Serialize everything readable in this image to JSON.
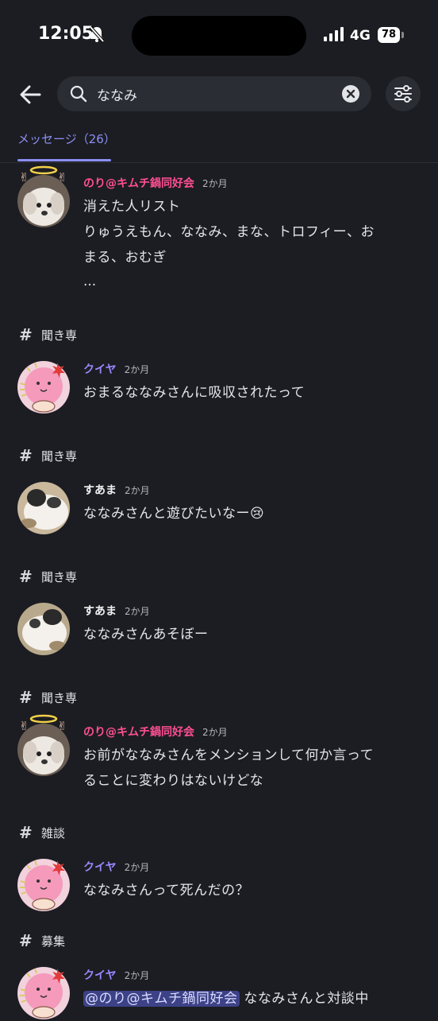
{
  "status": {
    "time": "12:05",
    "network": "4G",
    "battery": "78"
  },
  "search": {
    "query": "ななみ",
    "placeholder": ""
  },
  "tab": {
    "label": "メッセージ（26）"
  },
  "colors": {
    "accent": "#8c8ff5",
    "pink_name": "#ff4f93",
    "purple_name": "#9b86ff",
    "mention_bg": "#3d4287"
  },
  "results": [
    {
      "author": "のり@キムチ鍋同好会",
      "time": "2か月",
      "lines": [
        "消えた人リスト",
        "りゅうえもん、ななみ、まな、トロフィー、お",
        "まる、おむぎ"
      ],
      "more": "..."
    },
    {
      "channel": "聞き専",
      "author": "クイヤ",
      "time": "2か月",
      "lines": [
        "おまるななみさんに吸収されたって"
      ]
    },
    {
      "channel": "聞き専",
      "author": "すあま",
      "time": "2か月",
      "lines": [
        "ななみさんと遊びたいなー😢"
      ]
    },
    {
      "channel": "聞き専",
      "author": "すあま",
      "time": "2か月",
      "lines": [
        "ななみさんあそぼー"
      ]
    },
    {
      "channel": "聞き専",
      "author": "のり@キムチ鍋同好会",
      "time": "2か月",
      "lines": [
        "お前がななみさんをメンションして何か言って",
        "ることに変わりはないけどな"
      ]
    },
    {
      "channel": "雑談",
      "author": "クイヤ",
      "time": "2か月",
      "lines": [
        "ななみさんって死んだの？"
      ]
    },
    {
      "channel": "募集",
      "author": "クイヤ",
      "time": "2か月",
      "mention": "@のり@キムチ鍋同好会",
      "lines": [
        " ななみさんと対談中"
      ]
    }
  ]
}
